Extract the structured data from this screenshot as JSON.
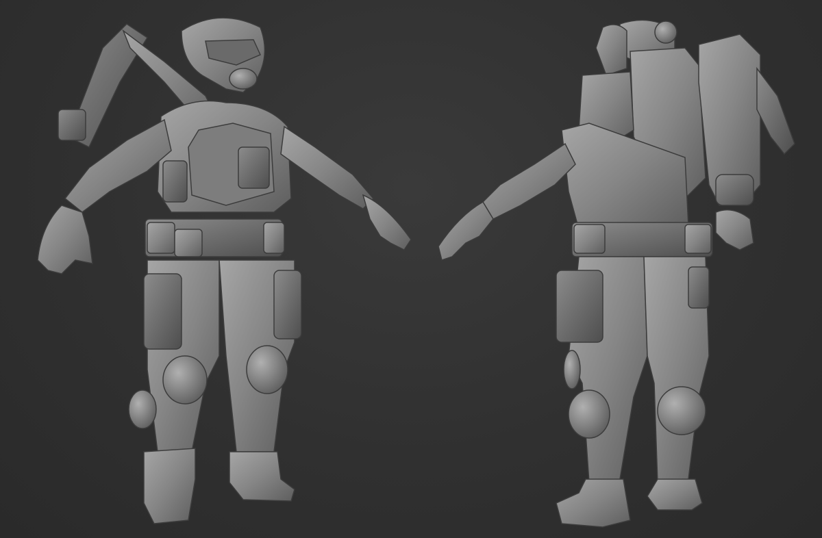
{
  "scene": {
    "description_hidden": "",
    "background_color": "#2f2f2f",
    "model_color": "#8a8a8a",
    "views": [
      {
        "id": "front",
        "label": ""
      },
      {
        "id": "back",
        "label": ""
      }
    ]
  }
}
